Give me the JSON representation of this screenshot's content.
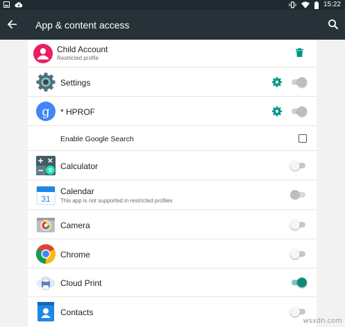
{
  "status_bar": {
    "time": "15:22",
    "icons": [
      "image-icon",
      "cloud-upload-icon",
      "vibrate-icon",
      "wifi-icon",
      "battery-icon"
    ]
  },
  "app_bar": {
    "title": "App & content access",
    "back_icon": "arrow-back-icon",
    "search_icon": "search-icon"
  },
  "profile": {
    "name": "Child Account",
    "subtitle": "Restricted profile",
    "delete_icon": "trash-icon"
  },
  "apps": [
    {
      "label": "Settings",
      "icon": "settings-gear-icon",
      "has_settings": true,
      "switch": "on-disabled"
    },
    {
      "label": "* HPROF",
      "icon": "google-g-icon",
      "has_settings": true,
      "switch": "on-disabled"
    },
    {
      "label": "Enable Google Search",
      "type": "checkbox",
      "checked": false
    },
    {
      "label": "Calculator",
      "icon": "calculator-icon",
      "switch": "off"
    },
    {
      "label": "Calendar",
      "subtitle": "This app is not supported in restricted profiles",
      "icon": "calendar-icon",
      "calendar_day": "31",
      "switch": "off-disabled"
    },
    {
      "label": "Camera",
      "icon": "camera-icon",
      "switch": "off"
    },
    {
      "label": "Chrome",
      "icon": "chrome-icon",
      "switch": "off"
    },
    {
      "label": "Cloud Print",
      "icon": "cloud-print-icon",
      "switch": "on"
    },
    {
      "label": "Contacts",
      "icon": "contacts-icon",
      "switch": "off"
    }
  ],
  "watermark": "wsxdn.com",
  "colors": {
    "app_bar": "#263238",
    "status_bar": "#1d2b30",
    "accent": "#009688",
    "background": "#f2f2f2"
  }
}
